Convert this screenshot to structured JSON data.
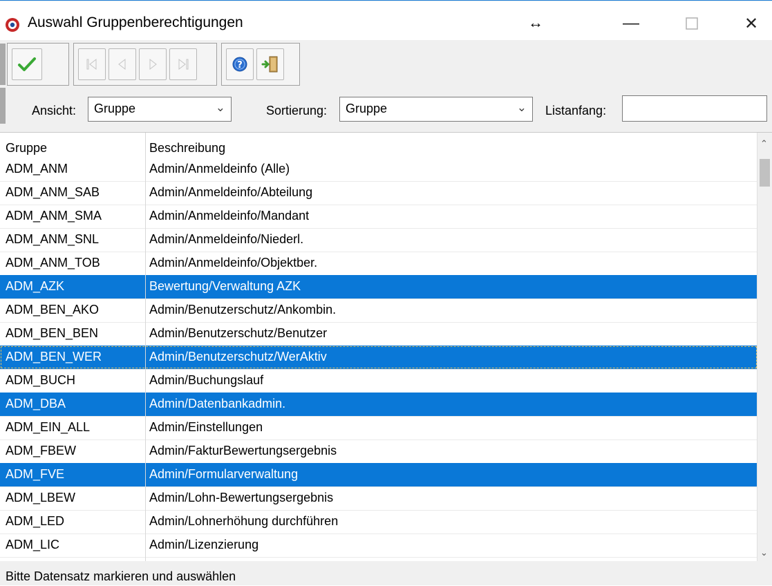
{
  "window": {
    "title": "Auswahl Gruppenberechtigungen",
    "resize_glyph": "↔",
    "minimize_glyph": "—",
    "close_glyph": "✕"
  },
  "toolbar": {
    "icons": [
      "ok-check-icon",
      "first-record-icon",
      "previous-record-icon",
      "next-record-icon",
      "last-record-icon",
      "help-icon",
      "exit-door-icon"
    ],
    "colors": {
      "check": "#3aa935",
      "help": "#2b6fd0",
      "exit": "#3f9f2f",
      "disabled": "#c4c4c4"
    }
  },
  "filter": {
    "ansicht_label": "Ansicht:",
    "ansicht_value": "Gruppe",
    "sortierung_label": "Sortierung:",
    "sortierung_value": "Gruppe",
    "listanfang_label": "Listanfang:",
    "listanfang_value": ""
  },
  "grid": {
    "columns": [
      "Gruppe",
      "Beschreibung"
    ],
    "rows": [
      {
        "gruppe": "ADM_ANM",
        "beschreibung": "Admin/Anmeldeinfo (Alle)",
        "selected": false
      },
      {
        "gruppe": "ADM_ANM_SAB",
        "beschreibung": "Admin/Anmeldeinfo/Abteilung",
        "selected": false
      },
      {
        "gruppe": "ADM_ANM_SMA",
        "beschreibung": "Admin/Anmeldeinfo/Mandant",
        "selected": false
      },
      {
        "gruppe": "ADM_ANM_SNL",
        "beschreibung": "Admin/Anmeldeinfo/Niederl.",
        "selected": false
      },
      {
        "gruppe": "ADM_ANM_TOB",
        "beschreibung": "Admin/Anmeldeinfo/Objektber.",
        "selected": false
      },
      {
        "gruppe": "ADM_AZK",
        "beschreibung": "Bewertung/Verwaltung AZK",
        "selected": true
      },
      {
        "gruppe": "ADM_BEN_AKO",
        "beschreibung": "Admin/Benutzerschutz/Ankombin.",
        "selected": false
      },
      {
        "gruppe": "ADM_BEN_BEN",
        "beschreibung": "Admin/Benutzerschutz/Benutzer",
        "selected": false
      },
      {
        "gruppe": "ADM_BEN_WER",
        "beschreibung": "Admin/Benutzerschutz/WerAktiv",
        "selected": true,
        "focused": true
      },
      {
        "gruppe": "ADM_BUCH",
        "beschreibung": "Admin/Buchungslauf",
        "selected": false
      },
      {
        "gruppe": "ADM_DBA",
        "beschreibung": "Admin/Datenbankadmin.",
        "selected": true
      },
      {
        "gruppe": "ADM_EIN_ALL",
        "beschreibung": "Admin/Einstellungen",
        "selected": false
      },
      {
        "gruppe": "ADM_FBEW",
        "beschreibung": "Admin/FakturBewertungsergebnis",
        "selected": false
      },
      {
        "gruppe": "ADM_FVE",
        "beschreibung": "Admin/Formularverwaltung",
        "selected": true
      },
      {
        "gruppe": "ADM_LBEW",
        "beschreibung": "Admin/Lohn-Bewertungsergebnis",
        "selected": false
      },
      {
        "gruppe": "ADM_LED",
        "beschreibung": "Admin/Lohnerhöhung durchführen",
        "selected": false
      },
      {
        "gruppe": "ADM_LIC",
        "beschreibung": "Admin/Lizenzierung",
        "selected": false
      }
    ],
    "selection_color": "#0a78d7"
  },
  "status": {
    "text": "Bitte Datensatz markieren und auswählen"
  }
}
